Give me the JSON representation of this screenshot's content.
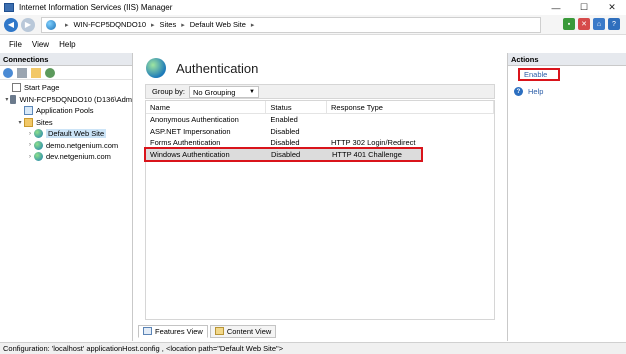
{
  "window": {
    "title": "Internet Information Services (IIS) Manager",
    "minimize": "—",
    "maximize": "☐",
    "close": "✕"
  },
  "address": {
    "crumbs": [
      "WIN-FCP5DQNDO10",
      "Sites",
      "Default Web Site"
    ],
    "separator": "▸"
  },
  "menu": [
    "File",
    "View",
    "Help"
  ],
  "connections": {
    "title": "Connections",
    "tree": [
      {
        "label": "Start Page",
        "icon": "start-page-icon",
        "expander": ""
      },
      {
        "label": "WIN-FCP5DQNDO10 (D136\\Adm",
        "icon": "server-icon",
        "expander": "▾"
      },
      {
        "label": "Application Pools",
        "icon": "app-pools-icon",
        "expander": ""
      },
      {
        "label": "Sites",
        "icon": "sites-folder-icon",
        "expander": "▾"
      },
      {
        "label": "Default Web Site",
        "icon": "website-globe-icon",
        "expander": "›"
      },
      {
        "label": "demo.netgenium.com",
        "icon": "website-globe-icon",
        "expander": "›"
      },
      {
        "label": "dev.netgenium.com",
        "icon": "website-globe-icon",
        "expander": "›"
      }
    ]
  },
  "main": {
    "title": "Authentication",
    "group_by_label": "Group by:",
    "group_by_value": "No Grouping",
    "columns": [
      "Name",
      "Status",
      "Response Type"
    ],
    "rows": [
      {
        "name": "Anonymous Authentication",
        "status": "Enabled",
        "response": ""
      },
      {
        "name": "ASP.NET Impersonation",
        "status": "Disabled",
        "response": ""
      },
      {
        "name": "Forms Authentication",
        "status": "Disabled",
        "response": "HTTP 302 Login/Redirect"
      },
      {
        "name": "Windows Authentication",
        "status": "Disabled",
        "response": "HTTP 401 Challenge"
      }
    ],
    "tabs": [
      "Features View",
      "Content View"
    ]
  },
  "actions": {
    "title": "Actions",
    "enable": "Enable",
    "help": "Help"
  },
  "status": "Configuration: 'localhost' applicationHost.config , <location path=\"Default Web Site\">",
  "colors": {
    "highlight": "#d9141b",
    "link": "#2c5ea8",
    "panel_header": "#e6e9ee"
  }
}
